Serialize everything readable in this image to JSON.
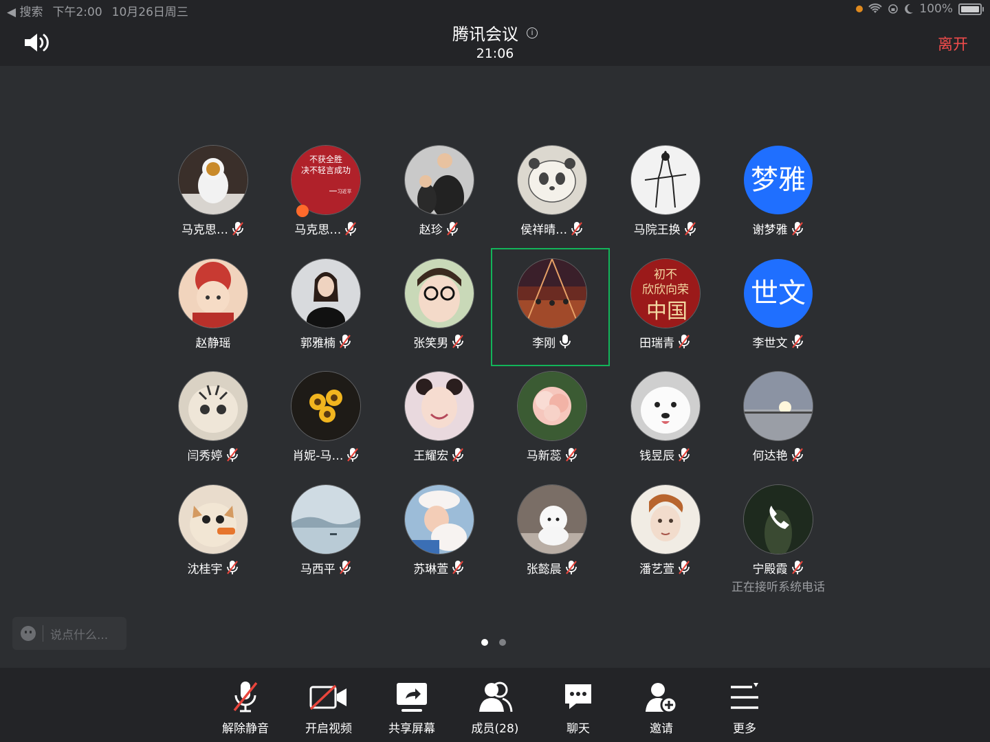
{
  "status_bar": {
    "back_label": "◀ 搜索",
    "time": "下午2:00",
    "date": "10月26日周三",
    "battery": "100%"
  },
  "header": {
    "title": "腾讯会议",
    "timer": "21:06",
    "leave_label": "离开"
  },
  "participants": [
    {
      "name": "马克思…",
      "muted": true,
      "avatar": "astronaut"
    },
    {
      "name": "马克思…",
      "muted": true,
      "avatar": "red-poster"
    },
    {
      "name": "赵珍",
      "muted": true,
      "avatar": "mother-child"
    },
    {
      "name": "侯祥晴…",
      "muted": true,
      "avatar": "panda"
    },
    {
      "name": "马院王换",
      "muted": true,
      "avatar": "sketch"
    },
    {
      "name": "谢梦雅",
      "muted": true,
      "avatar": "initials",
      "initials": "梦雅"
    },
    {
      "name": "赵静瑶",
      "muted": false,
      "no_mic": true,
      "avatar": "tiger-girl"
    },
    {
      "name": "郭雅楠",
      "muted": true,
      "avatar": "woman"
    },
    {
      "name": "张笑男",
      "muted": true,
      "avatar": "glasses-girl"
    },
    {
      "name": "李刚",
      "muted": false,
      "speaking": true,
      "avatar": "stage"
    },
    {
      "name": "田瑞青",
      "muted": true,
      "avatar": "china-calligraphy"
    },
    {
      "name": "李世文",
      "muted": true,
      "avatar": "initials",
      "initials": "世文"
    },
    {
      "name": "闫秀婷",
      "muted": true,
      "avatar": "tiger-toy"
    },
    {
      "name": "肖妮-马…",
      "muted": true,
      "avatar": "sunflowers"
    },
    {
      "name": "王耀宏",
      "muted": true,
      "avatar": "smiling-girl"
    },
    {
      "name": "马新蕊",
      "muted": true,
      "avatar": "flower"
    },
    {
      "name": "钱昱辰",
      "muted": true,
      "avatar": "dog"
    },
    {
      "name": "何达艳",
      "muted": true,
      "avatar": "sunset"
    },
    {
      "name": "沈桂宇",
      "muted": true,
      "avatar": "cat"
    },
    {
      "name": "马西平",
      "muted": true,
      "avatar": "lake"
    },
    {
      "name": "苏琳萱",
      "muted": true,
      "avatar": "baby"
    },
    {
      "name": "张懿晨",
      "muted": true,
      "avatar": "poodle"
    },
    {
      "name": "潘艺萱",
      "muted": true,
      "avatar": "drawing"
    },
    {
      "name": "宁殿霞",
      "muted": true,
      "avatar": "phone",
      "subtitle": "正在接听系统电话"
    }
  ],
  "chat": {
    "placeholder": "说点什么..."
  },
  "pagination": {
    "pages": 2,
    "current": 1
  },
  "toolbar": [
    {
      "label": "解除静音",
      "icon": "mic-off-icon"
    },
    {
      "label": "开启视频",
      "icon": "video-off-icon"
    },
    {
      "label": "共享屏幕",
      "icon": "share-screen-icon"
    },
    {
      "label": "成员(28)",
      "icon": "members-icon"
    },
    {
      "label": "聊天",
      "icon": "chat-icon"
    },
    {
      "label": "邀请",
      "icon": "invite-icon"
    },
    {
      "label": "更多",
      "icon": "more-icon"
    }
  ],
  "colors": {
    "background": "#2c2e31",
    "bar": "#232427",
    "leave": "#f04b4b",
    "active_speaker": "#12b55a",
    "initials_avatar": "#1f6fff",
    "mute_slash": "#e8453c"
  }
}
